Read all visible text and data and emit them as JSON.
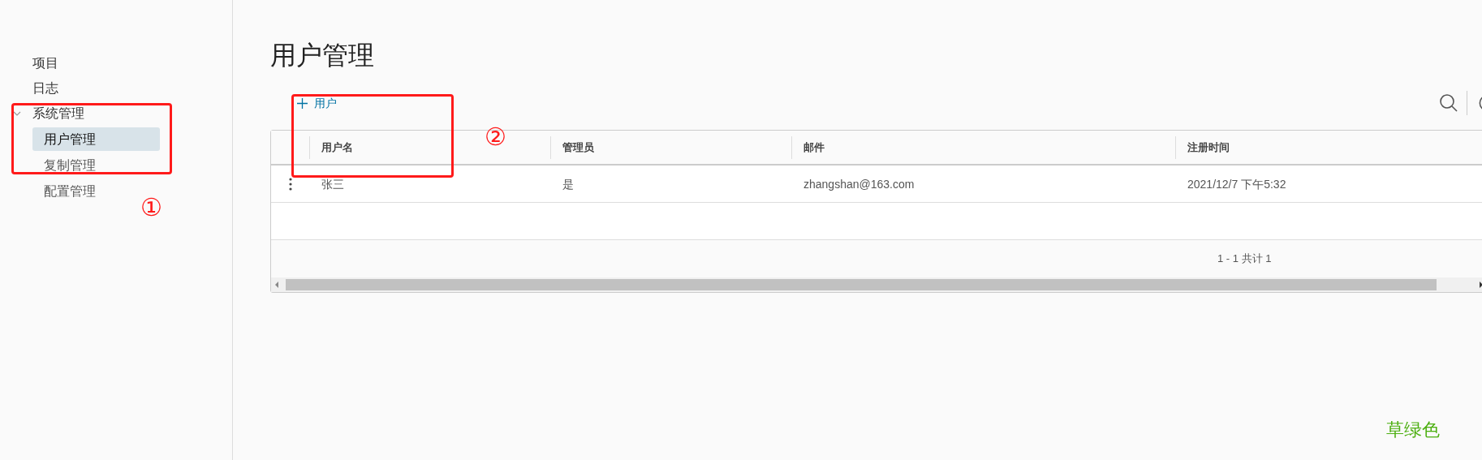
{
  "sidebar": {
    "items": [
      {
        "label": "项目",
        "selected": false
      },
      {
        "label": "日志",
        "selected": false
      },
      {
        "label": "系统管理",
        "expanded": true,
        "children": [
          {
            "label": "用户管理",
            "selected": true
          },
          {
            "label": "复制管理",
            "selected": false
          },
          {
            "label": "配置管理",
            "selected": false
          }
        ]
      }
    ]
  },
  "page_title": "用户管理",
  "add_button": {
    "label": "用户"
  },
  "table": {
    "columns": [
      "用户名",
      "管理员",
      "邮件",
      "注册时间"
    ],
    "rows": [
      {
        "cells": [
          "张三",
          "是",
          "zhangshan@163.com",
          "2021/12/7 下午5:32"
        ]
      }
    ],
    "footer": "1 - 1 共计 1"
  },
  "annotations": [
    {
      "kind": "box",
      "label": "①"
    },
    {
      "kind": "box",
      "label": "②"
    },
    {
      "kind": "note",
      "label": "草绿色",
      "color": "#4caf10"
    }
  ]
}
